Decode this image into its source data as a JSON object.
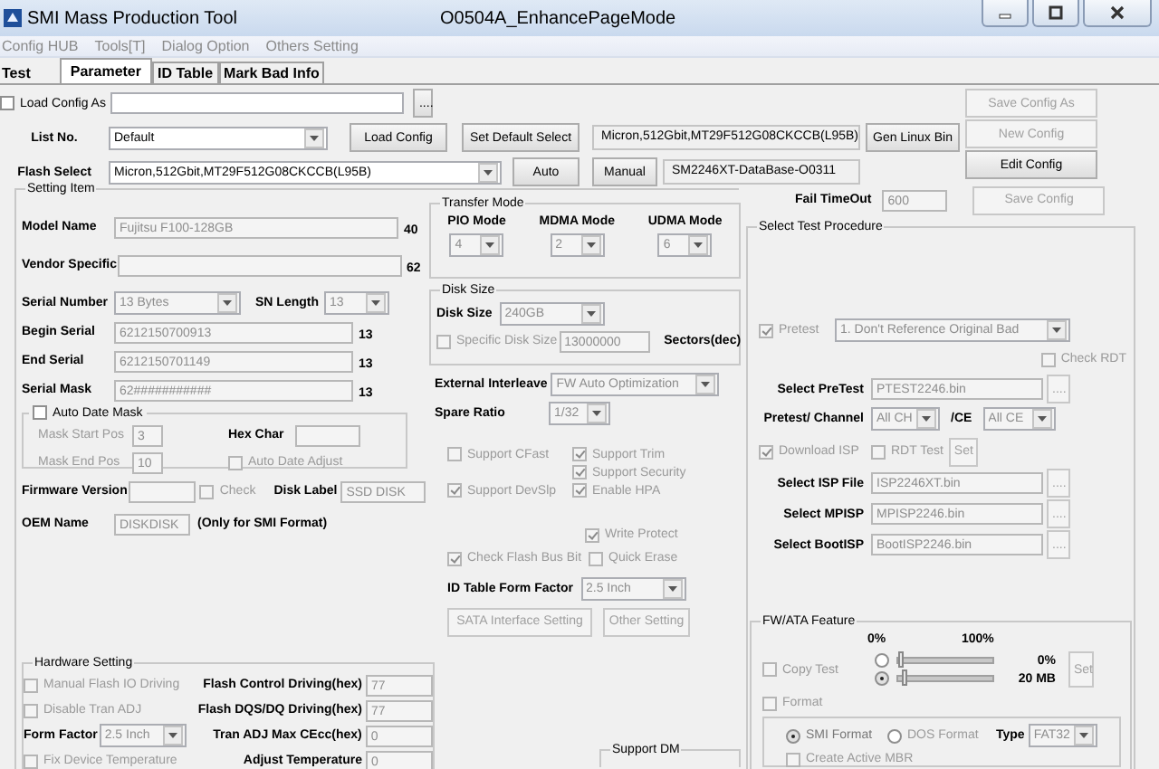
{
  "window": {
    "title": "SMI Mass Production Tool",
    "subtitle": "O0504A_EnhancePageMode"
  },
  "menu": [
    "Config HUB",
    "Tools[T]",
    "Dialog Option",
    "Others Setting"
  ],
  "tabs": [
    {
      "label": "Test",
      "selected": false
    },
    {
      "label": "Parameter",
      "selected": true
    },
    {
      "label": "ID Table",
      "selected": false
    },
    {
      "label": "Mark Bad Info",
      "selected": false
    }
  ],
  "config": {
    "load_config_as": {
      "label": "Load Config As",
      "checked": false,
      "disabled": false
    },
    "browse_button": {
      "label": "....",
      "disabled": false
    },
    "list_no": {
      "label": "List No.",
      "value": "Default",
      "disabled": false
    },
    "load_config_button": {
      "label": "Load Config",
      "disabled": false
    },
    "set_default_button": {
      "label": "Set Default Select",
      "disabled": false
    },
    "flash_info": "Micron,512Gbit,MT29F512G08CKCCB(L95B)",
    "gen_linux_button": {
      "label": "Gen Linux Bin",
      "disabled": false
    },
    "flash_select": {
      "label": "Flash Select",
      "value": "Micron,512Gbit,MT29F512G08CKCCB(L95B)",
      "disabled": false
    },
    "auto_button": {
      "label": "Auto",
      "disabled": false
    },
    "manual_button": {
      "label": "Manual",
      "disabled": false
    },
    "database_info": "SM2246XT-DataBase-O0311",
    "fail_timeout": {
      "label": "Fail TimeOut",
      "value": "600",
      "disabled": true
    }
  },
  "config_buttons": [
    {
      "label": "Save Config As",
      "disabled": true
    },
    {
      "label": "New Config",
      "disabled": true
    },
    {
      "label": "Edit Config",
      "disabled": false
    },
    {
      "label": "Save Config",
      "disabled": true
    }
  ],
  "setting_item": {
    "title": "Setting Item",
    "model_name": {
      "label": "Model Name",
      "value": "Fujitsu F100-128GB",
      "disabled": true,
      "limit": "40"
    },
    "vendor_specific": {
      "label": "Vendor Specific",
      "disabled": true,
      "limit": "62"
    },
    "serial_number": {
      "label": "Serial Number",
      "value": "13 Bytes",
      "disabled": true
    },
    "sn_length": {
      "label": "SN Length",
      "value": "13",
      "disabled": true
    },
    "begin_serial": {
      "label": "Begin Serial",
      "value": "6212150700913",
      "disabled": true,
      "limit": "13"
    },
    "end_serial": {
      "label": "End Serial",
      "value": "6212150701149",
      "disabled": true,
      "limit": "13"
    },
    "serial_mask": {
      "label": "Serial Mask",
      "value": "62###########",
      "disabled": true,
      "limit": "13"
    },
    "auto_date_mask": {
      "label": "Auto Date Mask",
      "checked": false,
      "disabled": false
    },
    "mask_start_pos": {
      "label": "Mask Start Pos",
      "value": "3",
      "disabled": true
    },
    "hex_char": {
      "label": "Hex Char",
      "disabled": true
    },
    "mask_end_pos": {
      "label": "Mask End Pos",
      "value": "10",
      "disabled": true
    },
    "auto_date_adjust": {
      "label": "Auto Date Adjust",
      "checked": false,
      "disabled": true
    },
    "firmware_version": {
      "label": "Firmware Version",
      "disabled": true
    },
    "check": {
      "label": "Check",
      "checked": false,
      "disabled": true
    },
    "disk_label": {
      "label": "Disk Label",
      "value": "SSD DISK",
      "disabled": true
    },
    "oem_name": {
      "label": "OEM Name",
      "value": "DISKDISK",
      "disabled": true,
      "note": "(Only for SMI Format)"
    }
  },
  "transfer_mode": {
    "title": "Transfer Mode",
    "modes": [
      {
        "label": "PIO Mode",
        "value": "4",
        "disabled": true
      },
      {
        "label": "MDMA Mode",
        "value": "2",
        "disabled": true
      },
      {
        "label": "UDMA Mode",
        "value": "6",
        "disabled": true
      }
    ]
  },
  "disk_size": {
    "title": "Disk Size",
    "size": {
      "label": "Disk Size",
      "value": "240GB",
      "disabled": true
    },
    "specific": {
      "label": "Specific Disk Size",
      "checked": false,
      "disabled": true
    },
    "sectors": {
      "value": "13000000",
      "disabled": true
    },
    "unit": "Sectors(dec)"
  },
  "external_interleave": {
    "label": "External Interleave",
    "value": "FW Auto Optimization",
    "disabled": true
  },
  "spare_ratio": {
    "label": "Spare Ratio",
    "value": "1/32",
    "disabled": true
  },
  "features": {
    "support_cfast": {
      "label": "Support CFast",
      "checked": false,
      "disabled": true
    },
    "support_trim": {
      "label": "Support Trim",
      "checked": true,
      "disabled": true
    },
    "support_security": {
      "label": "Support Security",
      "checked": true,
      "disabled": true
    },
    "support_devslp": {
      "label": "Support DevSlp",
      "checked": true,
      "disabled": true
    },
    "enable_hpa": {
      "label": "Enable HPA",
      "checked": true,
      "disabled": true
    },
    "write_protect": {
      "label": "Write Protect",
      "checked": true,
      "disabled": true
    },
    "check_flash_bus_bit": {
      "label": "Check Flash Bus Bit",
      "checked": true,
      "disabled": true
    },
    "quick_erase": {
      "label": "Quick Erase",
      "checked": false,
      "disabled": true
    }
  },
  "id_table_form_factor": {
    "label": "ID Table Form Factor",
    "value": "2.5 Inch",
    "disabled": true
  },
  "sata_button": {
    "label": "SATA Interface Setting",
    "disabled": true
  },
  "other_button": {
    "label": "Other Setting",
    "disabled": true
  },
  "support_dm": {
    "title": "Support DM"
  },
  "hardware_setting": {
    "title": "Hardware Setting",
    "manual_flash_io": {
      "label": "Manual Flash IO Driving",
      "checked": false,
      "disabled": true
    },
    "flash_control": {
      "label": "Flash Control Driving(hex)",
      "value": "77",
      "disabled": true
    },
    "disable_tran_adj": {
      "label": "Disable Tran ADJ",
      "checked": false,
      "disabled": true
    },
    "flash_dqs": {
      "label": "Flash DQS/DQ Driving(hex)",
      "value": "77",
      "disabled": true
    },
    "form_factor": {
      "label": "Form Factor",
      "value": "2.5 Inch",
      "disabled": true
    },
    "tran_adj": {
      "label": "Tran ADJ Max CEcc(hex)",
      "value": "0",
      "disabled": true
    },
    "fix_device_temperature": {
      "label": "Fix Device Temperature",
      "checked": false,
      "disabled": true
    },
    "adjust_temperature": {
      "label": "Adjust Temperature",
      "value": "0",
      "disabled": true
    }
  },
  "test_procedure": {
    "title": "Select Test Procedure",
    "pretest": {
      "label": "Pretest",
      "checked": true,
      "disabled": true
    },
    "pretest_mode": {
      "value": "1. Don't Reference Original Bad",
      "disabled": true
    },
    "check_rdt": {
      "label": "Check RDT",
      "checked": false,
      "disabled": true
    },
    "select_pretest": {
      "label": "Select PreTest",
      "value": "PTEST2246.bin",
      "disabled": true,
      "button": {
        "label": "....",
        "disabled": true
      }
    },
    "channel": {
      "label": "Pretest/ Channel",
      "value": "All CH",
      "disabled": true
    },
    "ce": {
      "label": "/CE",
      "value": "All CE",
      "disabled": true
    },
    "download_isp": {
      "label": "Download ISP",
      "checked": true,
      "disabled": true
    },
    "rdt_test": {
      "label": "RDT Test",
      "checked": false,
      "disabled": true
    },
    "set_button": {
      "label": "Set",
      "disabled": true
    },
    "isp_file": {
      "label": "Select ISP File",
      "value": "ISP2246XT.bin",
      "disabled": true,
      "button": {
        "label": "....",
        "disabled": true
      }
    },
    "mpisp": {
      "label": "Select MPISP",
      "value": "MPISP2246.bin",
      "disabled": true,
      "button": {
        "label": "....",
        "disabled": true
      }
    },
    "bootisp": {
      "label": "Select BootISP",
      "value": "BootISP2246.bin",
      "disabled": true,
      "button": {
        "label": "....",
        "disabled": true
      }
    }
  },
  "fw_ata": {
    "title": "FW/ATA Feature",
    "copy_test": {
      "label": "Copy Test",
      "checked": false,
      "disabled": true
    },
    "scale_min": "0%",
    "scale_max": "100%",
    "sliders": [
      {
        "selected": false,
        "level": 0,
        "reading": "0%"
      },
      {
        "selected": true,
        "level": 0.04,
        "reading": "20 MB"
      }
    ],
    "set_button": {
      "label": "Set",
      "disabled": true
    },
    "format": {
      "label": "Format",
      "checked": false,
      "disabled": true
    },
    "format_types": [
      {
        "label": "SMI Format",
        "selected": true
      },
      {
        "label": "DOS Format",
        "selected": false
      }
    ],
    "type": {
      "label": "Type",
      "value": "FAT32",
      "disabled": true
    },
    "create_mbr": {
      "label": "Create Active MBR",
      "checked": false,
      "disabled": true
    }
  }
}
